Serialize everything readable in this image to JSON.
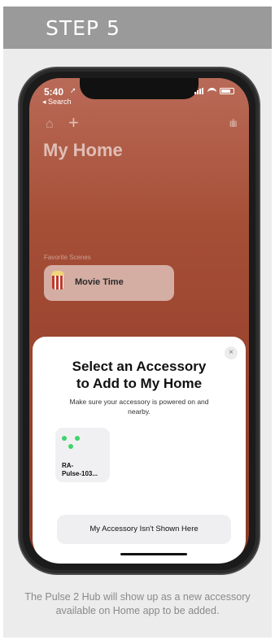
{
  "step": {
    "label": "STEP 5"
  },
  "status_bar": {
    "time": "5:40",
    "location_glyph": "➚",
    "back_label": "◂ Search"
  },
  "home_app": {
    "title": "My Home",
    "favorite_scenes_label": "Favorite Scenes",
    "scene": {
      "name": "Movie Time",
      "icon": "popcorn-icon"
    },
    "icons": {
      "home": "⌂",
      "add": "+",
      "voice": "ıılıı"
    }
  },
  "sheet": {
    "title_line1": "Select an Accessory",
    "title_line2": "to Add to My Home",
    "subtitle": "Make sure your accessory is powered on and nearby.",
    "close_glyph": "×",
    "accessory": {
      "name_line1": "RA-",
      "name_line2": "Pulse-103..."
    },
    "not_shown_label": "My Accessory Isn't Shown Here"
  },
  "caption": "The Pulse 2 Hub will show up as a new accessory available on Home app to be added.",
  "colors": {
    "accent": "#3dd46b",
    "step_bar": "#9a9a9a"
  }
}
